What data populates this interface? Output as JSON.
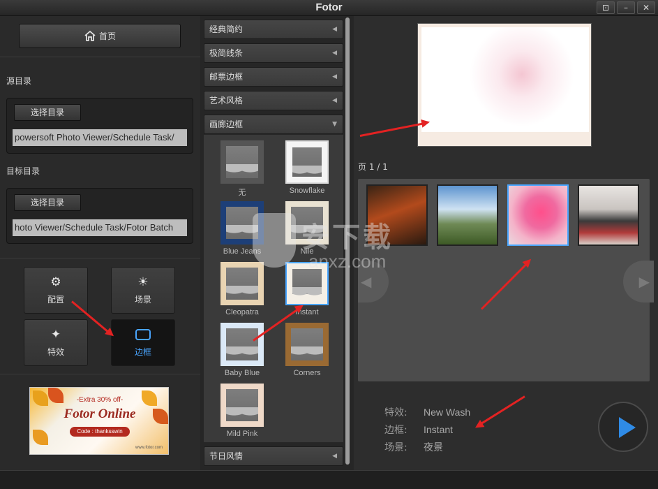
{
  "window": {
    "title": "Fotor",
    "buttons": [
      "⊡",
      "–",
      "✕"
    ]
  },
  "left": {
    "home_label": "首页",
    "source_label": "源目录",
    "source_btn": "选择目录",
    "source_path": "powersoft Photo Viewer/Schedule Task/",
    "target_label": "目标目录",
    "target_btn": "选择目录",
    "target_path": "hoto Viewer/Schedule Task/Fotor Batch",
    "modes": [
      {
        "label": "配置",
        "icon": "gear-icon"
      },
      {
        "label": "场景",
        "icon": "sun-icon"
      },
      {
        "label": "特效",
        "icon": "sparkle-icon"
      },
      {
        "label": "边框",
        "icon": "frame-icon",
        "active": true
      }
    ],
    "ad": {
      "extra": "-Extra 30% off-",
      "title": "Fotor Online",
      "code": "Code : thanksswin",
      "url": "www.fotor.com"
    }
  },
  "middle": {
    "categories": [
      "经典简约",
      "极简线条",
      "邮票边框",
      "艺术风格",
      "画廊边框"
    ],
    "footer_category": "节日风情",
    "frames": [
      "无",
      "Snowflake",
      "Blue Jeans",
      "Nile",
      "Cleopatra",
      "Instant",
      "Baby Blue",
      "Corners",
      "Mild Pink"
    ]
  },
  "right": {
    "page_label": "页",
    "page_current": "1",
    "page_total": "1",
    "info": [
      {
        "key": "特效:",
        "value": "New Wash"
      },
      {
        "key": "边框:",
        "value": "Instant"
      },
      {
        "key": "场景:",
        "value": "夜景"
      }
    ]
  },
  "watermark": {
    "text": "安下载",
    "url": "anxz.com"
  },
  "colors": {
    "accent": "#4aa6ff",
    "play": "#2f8be6",
    "annotation": "#e32222"
  }
}
